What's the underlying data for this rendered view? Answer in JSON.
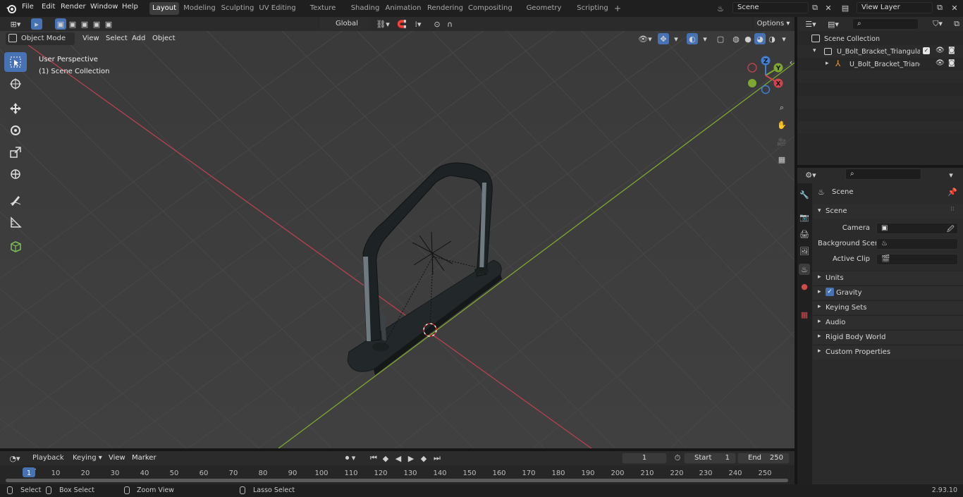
{
  "app": {
    "version": "2.93.10"
  },
  "menus": [
    "File",
    "Edit",
    "Render",
    "Window",
    "Help"
  ],
  "workspaces": [
    "Layout",
    "Modeling",
    "Sculpting",
    "UV Editing",
    "Texture Paint",
    "Shading",
    "Animation",
    "Rendering",
    "Compositing",
    "Geometry Nodes",
    "Scripting"
  ],
  "active_workspace": "Layout",
  "scene_field": "Scene",
  "view_layer_field": "View Layer",
  "viewport_header": {
    "mode": "Object Mode",
    "menus": [
      "View",
      "Select",
      "Add",
      "Object"
    ],
    "transform_orientation": "Global",
    "options_label": "Options"
  },
  "viewport": {
    "overlay_line1": "User Perspective",
    "overlay_line2": "(1) Scene Collection",
    "gizmo_axes": {
      "x": "X",
      "y": "Y",
      "z": "Z"
    },
    "colors": {
      "x_axis": "#b8414f",
      "y_axis": "#7ea82f",
      "z_axis": "#3f7fd6",
      "grid_bg": "#3a3a3a"
    }
  },
  "outliner": {
    "root": "Scene Collection",
    "items": [
      {
        "label": "U_Bolt_Bracket_Triangular_St",
        "type": "collection"
      },
      {
        "label": "U_Bolt_Bracket_Triangul",
        "type": "object"
      }
    ]
  },
  "properties": {
    "context_label": "Scene",
    "section_title": "Scene",
    "fields": [
      {
        "label": "Camera",
        "value": ""
      },
      {
        "label": "Background Scene",
        "value": ""
      },
      {
        "label": "Active Clip",
        "value": ""
      }
    ],
    "panels": [
      "Units",
      "Gravity",
      "Keying Sets",
      "Audio",
      "Rigid Body World",
      "Custom Properties"
    ],
    "gravity_checked": true
  },
  "timeline": {
    "menus": [
      "Playback",
      "Keying",
      "View",
      "Marker"
    ],
    "current_frame": "1",
    "start_label": "Start",
    "start_value": "1",
    "end_label": "End",
    "end_value": "250",
    "ruler": [
      "1",
      "10",
      "20",
      "30",
      "40",
      "50",
      "60",
      "70",
      "80",
      "90",
      "100",
      "110",
      "120",
      "130",
      "140",
      "150",
      "160",
      "170",
      "180",
      "190",
      "200",
      "210",
      "220",
      "230",
      "240",
      "250"
    ]
  },
  "statusbar": {
    "items": [
      {
        "label": "Select"
      },
      {
        "label": "Box Select"
      },
      {
        "label": "Zoom View"
      },
      {
        "label": "Lasso Select"
      }
    ]
  }
}
